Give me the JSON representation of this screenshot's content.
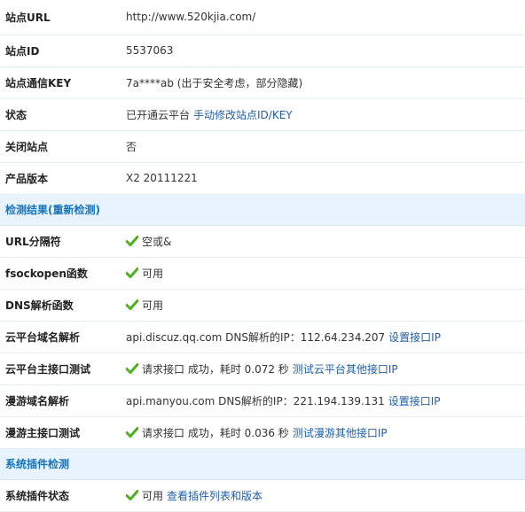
{
  "rows": {
    "site_url": {
      "label": "站点URL",
      "value": "http://www.520kjia.com/"
    },
    "site_id": {
      "label": "站点ID",
      "value": "5537063"
    },
    "site_key": {
      "label": "站点通信KEY",
      "value": "7a****ab (出于安全考虑，部分隐藏)"
    },
    "status": {
      "label": "状态",
      "value": "已开通云平台",
      "link": "手动修改站点ID/KEY"
    },
    "close_site": {
      "label": "关闭站点",
      "value": "否"
    },
    "version": {
      "label": "产品版本",
      "value": "X2 20111221"
    }
  },
  "section_check": {
    "title": "检测结果(",
    "link": "重新检测",
    "suffix": ")"
  },
  "checks": {
    "url_sep": {
      "label": "URL分隔符",
      "value": "空或&"
    },
    "fsockopen": {
      "label": "fsockopen函数",
      "value": "可用"
    },
    "dns_func": {
      "label": "DNS解析函数",
      "value": "可用"
    },
    "cloud_dns": {
      "label": "云平台域名解析",
      "value": "api.discuz.qq.com DNS解析的IP：112.64.234.207",
      "link": "设置接口IP"
    },
    "cloud_test": {
      "label": "云平台主接口测试",
      "value": "请求接口 成功，耗时 0.072 秒",
      "link": "测试云平台其他接口IP"
    },
    "manyou_dns": {
      "label": "漫游域名解析",
      "value": "api.manyou.com DNS解析的IP：221.194.139.131",
      "link": "设置接口IP"
    },
    "manyou_test": {
      "label": "漫游主接口测试",
      "value": "请求接口 成功，耗时 0.036 秒",
      "link": "测试漫游其他接口IP"
    }
  },
  "section_plugin": {
    "title": "系统插件检测"
  },
  "plugin": {
    "status": {
      "label": "系统插件状态",
      "value": "可用",
      "link": "查看插件列表和版本"
    }
  },
  "icons": {
    "ok": "check-icon"
  },
  "colors": {
    "ok_green": "#4caf1f",
    "link": "#1f5ea8",
    "section_bg": "#e8f3fd",
    "section_text": "#1574bd"
  }
}
